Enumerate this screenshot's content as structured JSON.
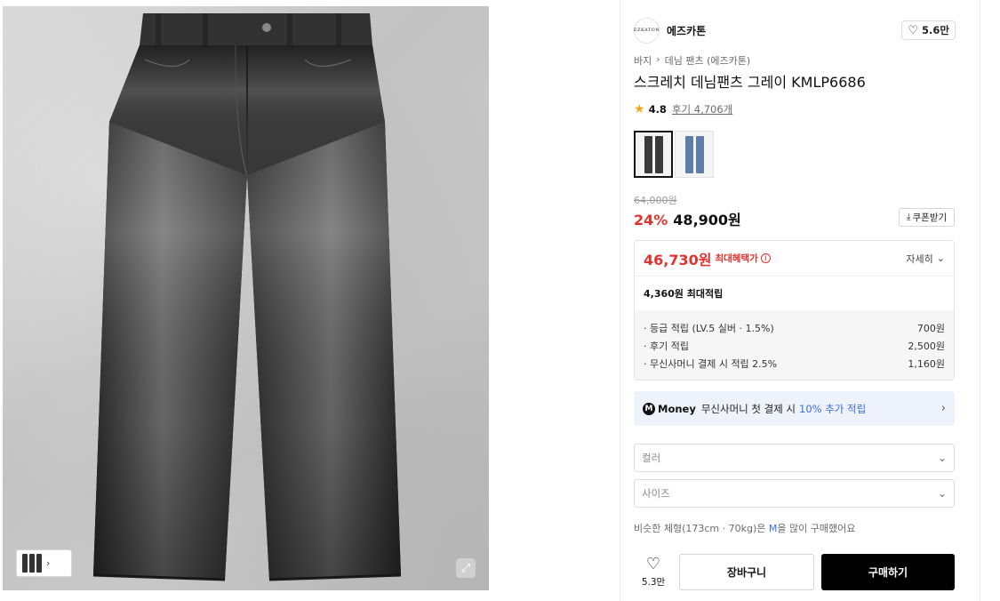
{
  "gallery": {
    "expand_icon": "expand-icon",
    "thumb_arrow": "›"
  },
  "brand": {
    "logo_text": "EZKATON",
    "name": "에즈카톤",
    "like_count": "5.6만"
  },
  "breadcrumb": [
    "바지",
    "›",
    "데님 팬츠 (에즈카톤)"
  ],
  "product": {
    "title": "스크레치 데님팬츠 그레이 KMLP6686",
    "rating": "4.8",
    "reviews": "후기 4,706개",
    "swatches": [
      {
        "name": "gray-black",
        "color": "#3a3a3a",
        "active": true
      },
      {
        "name": "blue",
        "color": "#5d7ea6",
        "active": false
      }
    ]
  },
  "price": {
    "original": "64,000원",
    "discount_rate": "24%",
    "sale": "48,900원",
    "coupon_label": "쿠폰받기"
  },
  "benefit": {
    "max_price": "46,730원",
    "max_label": "최대혜택가",
    "detail_label": "자세히",
    "points_total": "4,360원 최대적립",
    "rows": [
      {
        "label": "· 등급 적립 (LV.5 실버 · 1.5%)",
        "value": "700원"
      },
      {
        "label": "· 후기 적립",
        "value": "2,500원"
      },
      {
        "label": "· 무신사머니 결제 시 적립 2.5%",
        "value": "1,160원"
      }
    ]
  },
  "money_banner": {
    "badge": "M",
    "name": "Money",
    "text": "무신사머니 첫 결제 시",
    "accent": "10% 추가 적립"
  },
  "options": {
    "color_placeholder": "컬러",
    "size_placeholder": "사이즈"
  },
  "recommend": {
    "prefix": "비슷한 체형(173cm · 70kg)은",
    "size": "M",
    "suffix": "을 많이 구매했어요"
  },
  "cta": {
    "wish_count": "5.3만",
    "cart_label": "장바구니",
    "buy_label": "구매하기"
  },
  "colors": {
    "accent_red": "#e0322e",
    "accent_blue": "#3b6fe0",
    "buy_button": "#000000"
  }
}
